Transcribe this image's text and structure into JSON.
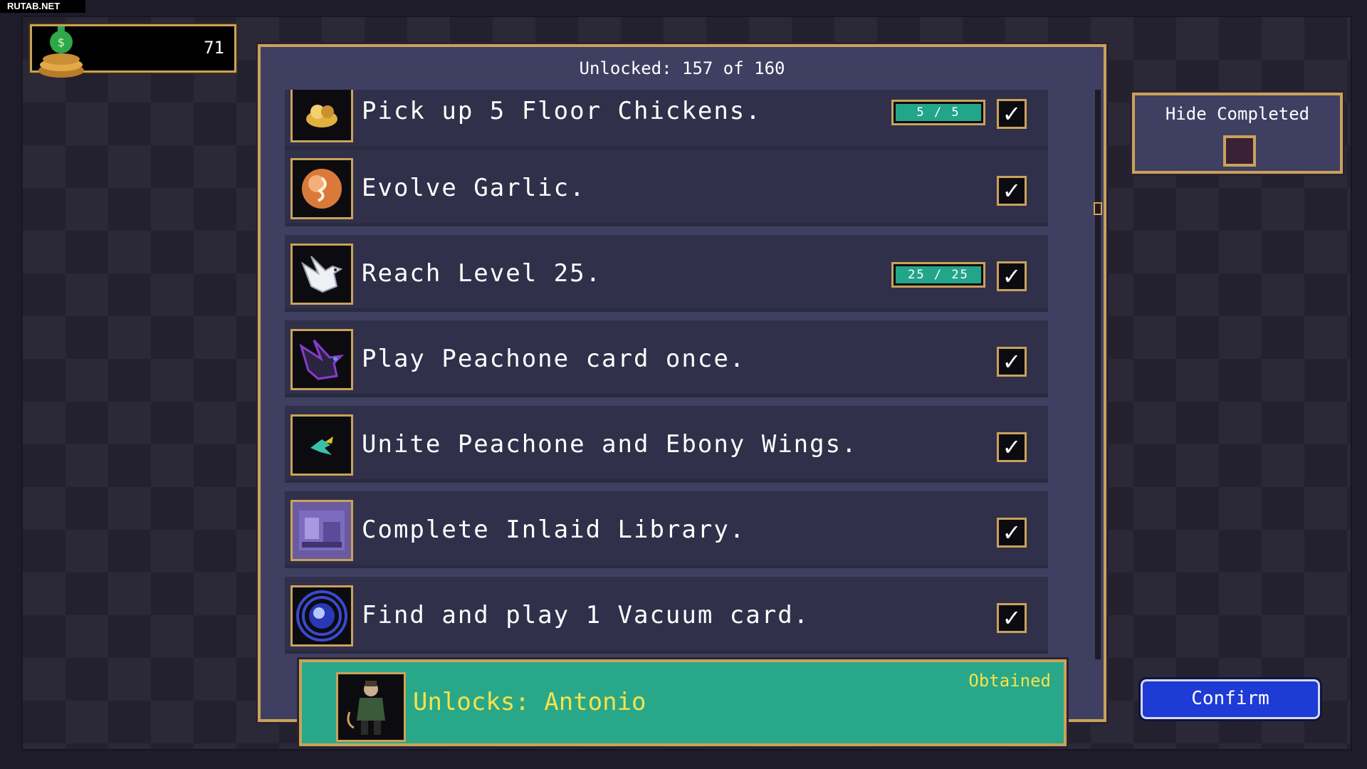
{
  "watermark": "RUTAB.NET",
  "coins": {
    "value": "71",
    "icon": "coin-bag-icon"
  },
  "panel": {
    "title": "Unlocked: 157 of 160"
  },
  "achievements": [
    {
      "text": "Pick up 5 Floor Chickens.",
      "progress": "5 / 5",
      "progress_fraction": 1.0,
      "completed": true,
      "icon": "floor-chicken-icon"
    },
    {
      "text": "Evolve Garlic.",
      "completed": true,
      "icon": "garlic-orb-icon"
    },
    {
      "text": "Reach Level 25.",
      "progress": "25 / 25",
      "progress_fraction": 1.0,
      "completed": true,
      "icon": "white-dove-icon"
    },
    {
      "text": "Play Peachone card once.",
      "completed": true,
      "icon": "dark-bird-icon"
    },
    {
      "text": "Unite Peachone and Ebony Wings.",
      "completed": true,
      "icon": "teal-bird-icon"
    },
    {
      "text": "Complete Inlaid Library.",
      "completed": true,
      "icon": "library-stage-icon"
    },
    {
      "text": "Find and play 1 Vacuum card.",
      "completed": true,
      "icon": "vacuum-orb-icon"
    }
  ],
  "unlock": {
    "label": "Unlocks: Antonio",
    "status": "Obtained",
    "icon": "antonio-portrait-icon"
  },
  "hide_completed": {
    "label": "Hide Completed",
    "checked": false
  },
  "confirm": {
    "label": "Confirm"
  },
  "colors": {
    "gold_border": "#c9a25a",
    "progress_fill": "#23a58a",
    "unlock_bg": "#28a889",
    "unlock_text": "#f7e24a",
    "confirm_bg": "#1e3bd6"
  }
}
